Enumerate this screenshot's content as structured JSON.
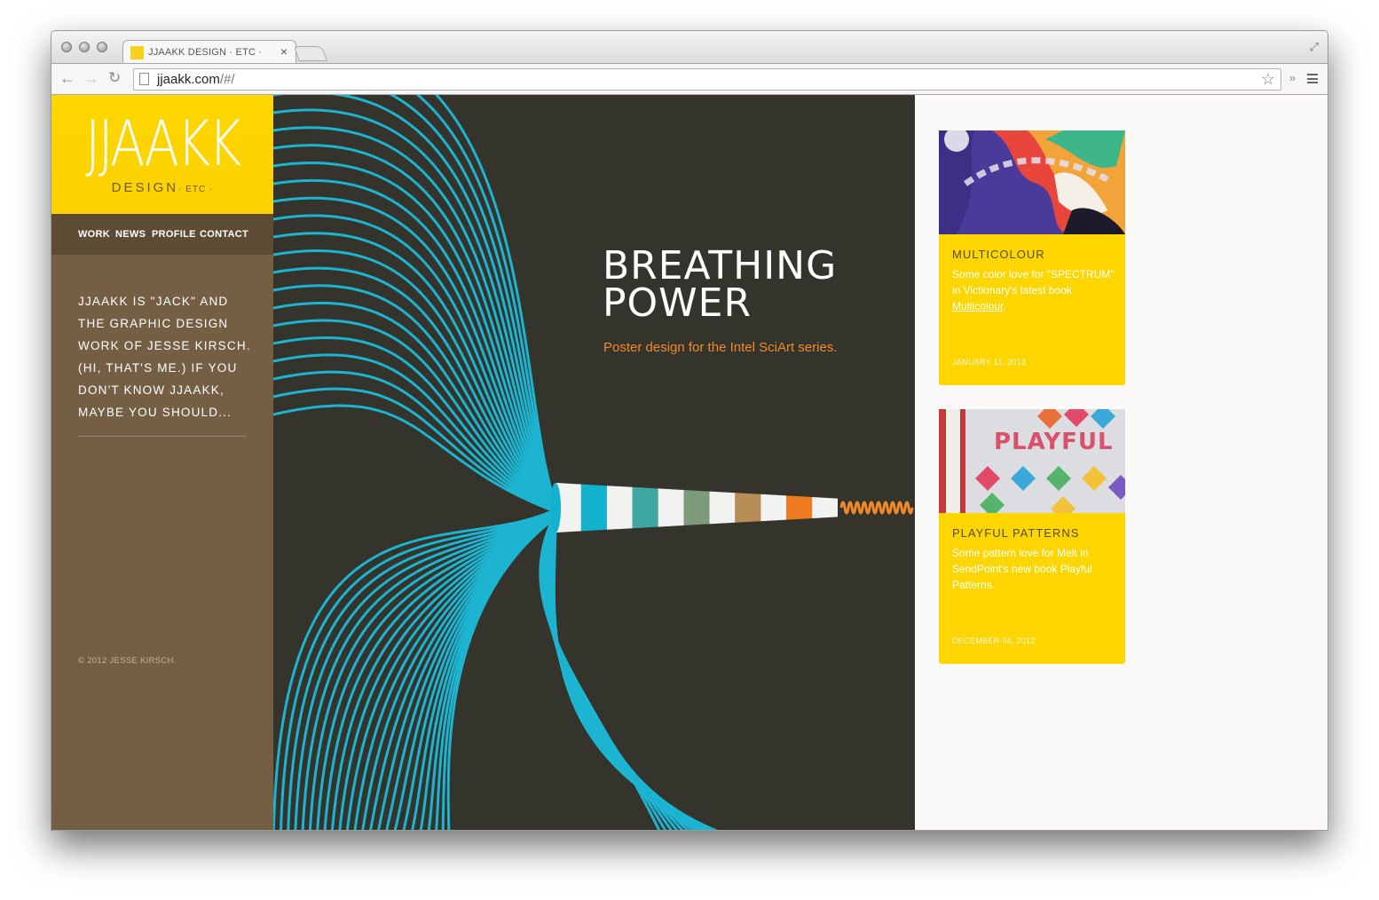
{
  "browser": {
    "tab_title": "JJAAKK DESIGN · ETC ·",
    "tab_close": "×",
    "url_domain": "jjaakk.com",
    "url_rest": "/#/"
  },
  "sidebar": {
    "logo_main": "JJAAKK",
    "logo_sub": "DESIGN",
    "logo_etc": "· ETC ·",
    "nav": [
      {
        "label": "WORK"
      },
      {
        "label": "NEWS"
      },
      {
        "label": "PROFILE"
      },
      {
        "label": "CONTACT"
      }
    ],
    "intro_lines": [
      "JJAAKK IS \"JACK\" AND",
      "THE GRAPHIC DESIGN",
      "WORK OF JESSE KIRSCH.",
      "(HI, THAT'S ME.) IF YOU",
      "DON'T KNOW JJAAKK,",
      "MAYBE YOU SHOULD..."
    ],
    "copyright": "© 2012 JESSE KIRSCH."
  },
  "hero": {
    "title_line1": "BREATHING",
    "title_line2": "POWER",
    "subtitle": "Poster design for the Intel SciArt series."
  },
  "news": [
    {
      "title": "MULTICOLOUR",
      "text": "Some color love for \"SPECTRUM\" in Victionary's latest book ",
      "link": "Multicolour",
      "text_end": ".",
      "date": "JANUARY 11, 2013"
    },
    {
      "title": "PLAYFUL PATTERNS",
      "text": "Some pattern love for Melt in SendPoint's new book Playful Patterns.",
      "date": "DECEMBER 04, 2012",
      "thumb_text": "PLAYFUL"
    }
  ],
  "colors": {
    "brand_yellow": "#fed600",
    "sidebar_brown": "#755f44",
    "nav_brown": "#5e4b35",
    "hero_bg": "#34332c",
    "line_cyan": "#1cb4d0",
    "accent_orange": "#f08a2b"
  }
}
